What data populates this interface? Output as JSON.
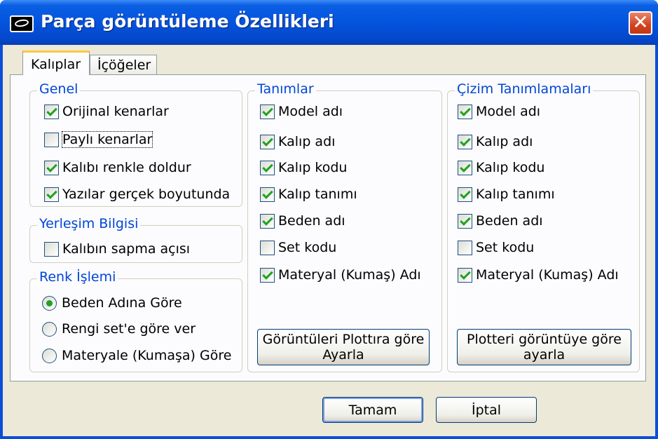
{
  "window": {
    "title": "Parça görüntüleme Özellikleri",
    "close_glyph": "✕",
    "icon": "app-icon"
  },
  "tabs": [
    {
      "label": "Kalıplar",
      "active": true
    },
    {
      "label": "İçöğeler",
      "active": false
    }
  ],
  "genel": {
    "title": "Genel",
    "items": [
      {
        "label": "Orijinal kenarlar",
        "checked": true
      },
      {
        "label": "Paylı kenarlar",
        "checked": false
      },
      {
        "label": "Kalıbı renkle doldur",
        "checked": true
      },
      {
        "label": "Yazılar gerçek boyutunda",
        "checked": true
      }
    ]
  },
  "yerlesim": {
    "title": "Yerleşim Bilgisi",
    "items": [
      {
        "label": "Kalıbın sapma açısı",
        "checked": false
      }
    ]
  },
  "renk": {
    "title": "Renk İşlemi",
    "options": [
      {
        "label": "Beden Adına Göre",
        "selected": true
      },
      {
        "label": "Rengi set'e göre ver",
        "selected": false
      },
      {
        "label": "Materyale (Kumaşa) Göre",
        "selected": false
      }
    ]
  },
  "tanimlar": {
    "title": "Tanımlar",
    "items": [
      {
        "label": "Model adı",
        "checked": true
      },
      {
        "label": "Kalıp adı",
        "checked": true
      },
      {
        "label": "Kalıp kodu",
        "checked": true
      },
      {
        "label": "Kalıp tanımı",
        "checked": true
      },
      {
        "label": "Beden adı",
        "checked": true
      },
      {
        "label": "Set kodu",
        "checked": false
      },
      {
        "label": "Materyal (Kumaş) Adı",
        "checked": true
      }
    ],
    "button_line1": "Görüntüleri Plottıra göre",
    "button_line2": "Ayarla"
  },
  "cizim": {
    "title": "Çizim Tanımlamaları",
    "items": [
      {
        "label": "Model adı",
        "checked": true
      },
      {
        "label": "Kalıp adı",
        "checked": true
      },
      {
        "label": "Kalıp kodu",
        "checked": true
      },
      {
        "label": "Kalıp tanımı",
        "checked": true
      },
      {
        "label": "Beden adı",
        "checked": true
      },
      {
        "label": "Set kodu",
        "checked": false
      },
      {
        "label": "Materyal (Kumaş) Adı",
        "checked": true
      }
    ],
    "button_line1": "Plotteri görüntüye göre",
    "button_line2": "ayarla"
  },
  "footer": {
    "ok_label": "Tamam",
    "cancel_label": "İptal"
  },
  "colors": {
    "title_bar": "#0554de",
    "group_title": "#0046d5",
    "check_mark": "#21a121",
    "close_button": "#d4411f"
  }
}
